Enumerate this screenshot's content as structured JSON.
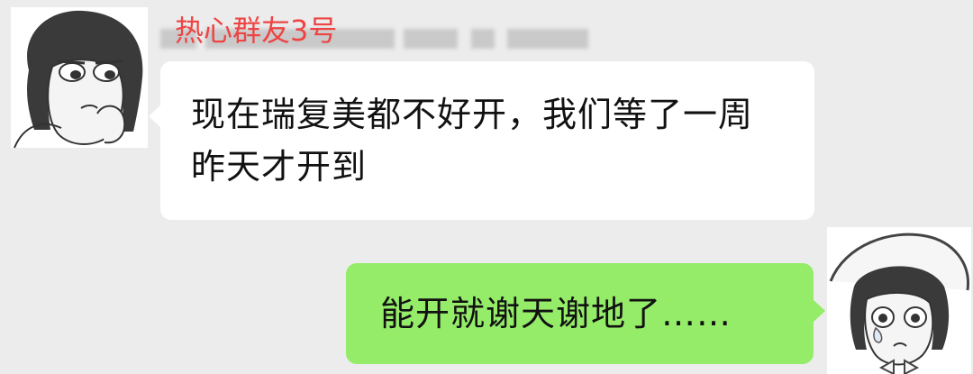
{
  "colors": {
    "background": "#ececec",
    "incoming_bubble": "#ffffff",
    "outgoing_bubble": "#95ec69",
    "sender_label": "#ee4444",
    "text": "#111111"
  },
  "messages": [
    {
      "direction": "incoming",
      "sender_label": "热心群友3号",
      "text": "现在瑞复美都不好开，我们等了一周昨天才开到",
      "avatar_icon": "cartoon-girl-avatar-icon"
    },
    {
      "direction": "outgoing",
      "text": "能开就谢天谢地了……",
      "avatar_icon": "cartoon-girl-hat-avatar-icon"
    }
  ]
}
